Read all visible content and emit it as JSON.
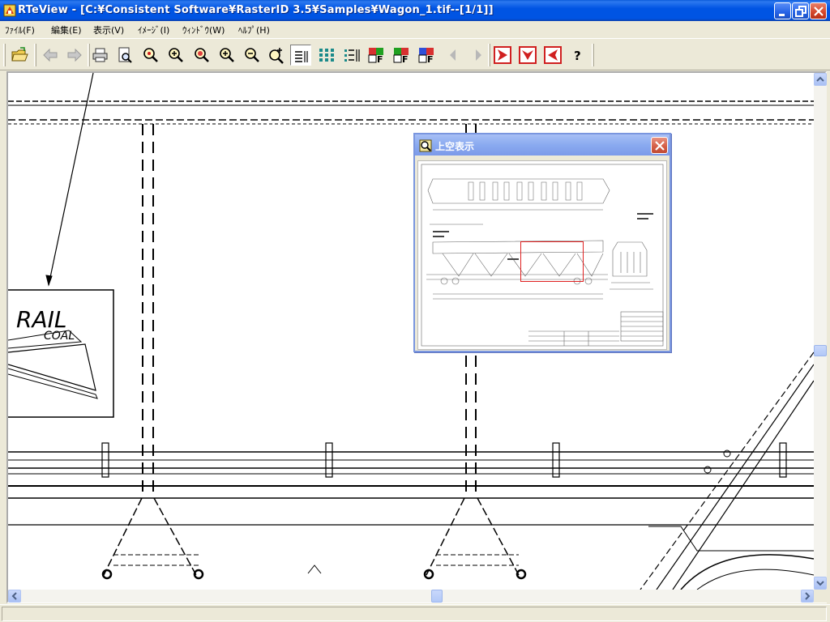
{
  "window": {
    "title": "RTeView - [C:¥Consistent Software¥RasterID 3.5¥Samples¥Wagon_1.tif--[1/1]]"
  },
  "menu": [
    {
      "id": "file",
      "label": "ﾌｧｲﾙ(F)"
    },
    {
      "id": "edit",
      "label": "編集(E)"
    },
    {
      "id": "view",
      "label": "表示(V)"
    },
    {
      "id": "image",
      "label": "ｲﾒｰｼﾞ(I)"
    },
    {
      "id": "window",
      "label": "ｳｨﾝﾄﾞｳ(W)"
    },
    {
      "id": "help",
      "label": "ﾍﾙﾌﾟ(H)"
    }
  ],
  "toolbar": {
    "buttons": [
      "open-icon",
      "back-arrow-icon",
      "forward-arrow-icon",
      "print-icon",
      "print-preview-icon",
      "zoom-icon",
      "zoom-in-icon",
      "zoom-fit-icon",
      "zoom-in-plus-icon",
      "zoom-out-icon",
      "zoom-window-icon",
      "lines-view-icon",
      "grid-view-icon",
      "list-view-icon",
      "frame-f1-icon",
      "frame-f2-icon",
      "frame-f3-icon",
      "prev-page-icon",
      "next-page-icon",
      "red-right-icon",
      "red-down-icon",
      "red-left-icon",
      "help-icon"
    ]
  },
  "drawing": {
    "label_rail": "RAIL",
    "label_coal": "COAL"
  },
  "overview": {
    "title": "上空表示"
  },
  "colors": {
    "titlebar": "#0054e3",
    "background": "#ece9d8",
    "viewport_rect": "#e02020"
  }
}
